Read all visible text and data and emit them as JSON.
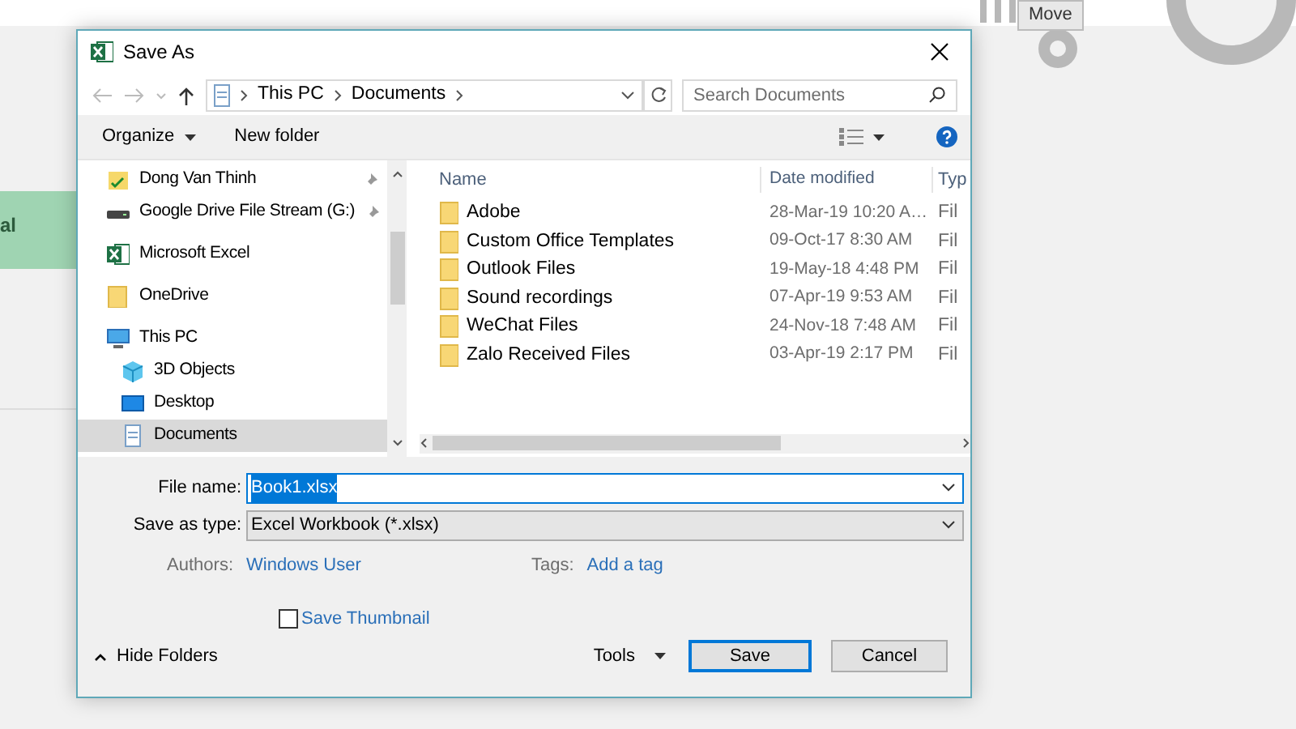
{
  "background": {
    "side_label": "al",
    "tab_label": "Move"
  },
  "dialog": {
    "title": "Save As",
    "address": {
      "crumbs": [
        "This PC",
        "Documents"
      ]
    },
    "search": {
      "placeholder": "Search Documents"
    },
    "toolbar": {
      "organize": "Organize",
      "new_folder": "New folder"
    },
    "nav": [
      {
        "children": [
          {
            "label": "Dong Van Thinh",
            "kind": "user",
            "pinned": true,
            "selected": false
          },
          {
            "label": "Google Drive File Stream (G:)",
            "kind": "drive",
            "pinned": true,
            "selected": false
          }
        ]
      },
      {
        "label": "Microsoft Excel",
        "kind": "app",
        "selected": false
      },
      {
        "label": "OneDrive",
        "kind": "folder",
        "selected": false
      },
      {
        "label": "This PC",
        "kind": "pc",
        "selected": false,
        "children": [
          {
            "label": "3D Objects",
            "kind": "cube",
            "selected": false
          },
          {
            "label": "Desktop",
            "kind": "desktop",
            "selected": false
          },
          {
            "label": "Documents",
            "kind": "document",
            "selected": true
          }
        ]
      }
    ],
    "columns": [
      "Name",
      "Date modified",
      "Typ"
    ],
    "files": [
      {
        "name": "Adobe",
        "date": "28-Mar-19 10:20 A…",
        "type": "Fil"
      },
      {
        "name": "Custom Office Templates",
        "date": "09-Oct-17 8:30 AM",
        "type": "Fil"
      },
      {
        "name": "Outlook Files",
        "date": "19-May-18 4:48 PM",
        "type": "Fil"
      },
      {
        "name": "Sound recordings",
        "date": "07-Apr-19 9:53 AM",
        "type": "Fil"
      },
      {
        "name": "WeChat Files",
        "date": "24-Nov-18 7:48 AM",
        "type": "Fil"
      },
      {
        "name": "Zalo Received Files",
        "date": "03-Apr-19 2:17 PM",
        "type": "Fil"
      }
    ],
    "form": {
      "file_name_label": "File name:",
      "file_name": "Book1.xlsx",
      "file_name_selected": true,
      "type_label": "Save as type:",
      "type": "Excel Workbook (*.xlsx)",
      "authors_label": "Authors:",
      "authors": "Windows User",
      "tags_label": "Tags:",
      "tags": "Add a tag",
      "thumbnail": {
        "label": "Save Thumbnail",
        "checked": false
      }
    },
    "footer": {
      "hide_folders": "Hide Folders",
      "tools": "Tools",
      "save": "Save",
      "cancel": "Cancel"
    }
  }
}
